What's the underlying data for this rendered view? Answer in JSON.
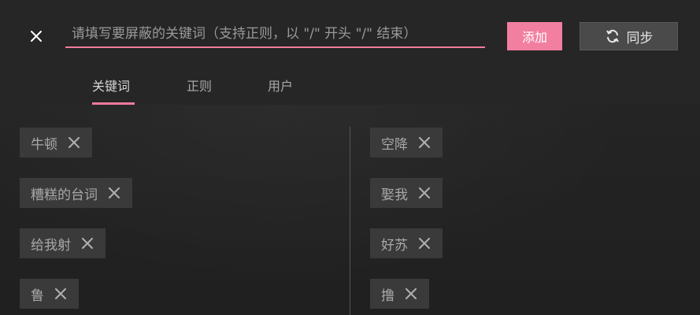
{
  "search": {
    "placeholder": "请填写要屏蔽的关键词（支持正则，以 \"/\" 开头 \"/\" 结束）",
    "value": ""
  },
  "buttons": {
    "add_label": "添加",
    "sync_label": "同步"
  },
  "tabs": [
    {
      "label": "关键词",
      "active": true
    },
    {
      "label": "正则",
      "active": false
    },
    {
      "label": "用户",
      "active": false
    }
  ],
  "keywords": {
    "left": [
      {
        "label": "牛顿"
      },
      {
        "label": "糟糕的台词"
      },
      {
        "label": "给我射"
      },
      {
        "label": "鲁"
      }
    ],
    "right": [
      {
        "label": "空降"
      },
      {
        "label": "娶我"
      },
      {
        "label": "好苏"
      },
      {
        "label": "撸"
      }
    ]
  },
  "colors": {
    "accent": "#f27ea0",
    "background": "#222222",
    "chip": "#3a3a3a",
    "sync_button": "#4a4a4a"
  },
  "icons": {
    "close": "close-icon",
    "sync": "sync-icon",
    "remove": "remove-icon"
  }
}
